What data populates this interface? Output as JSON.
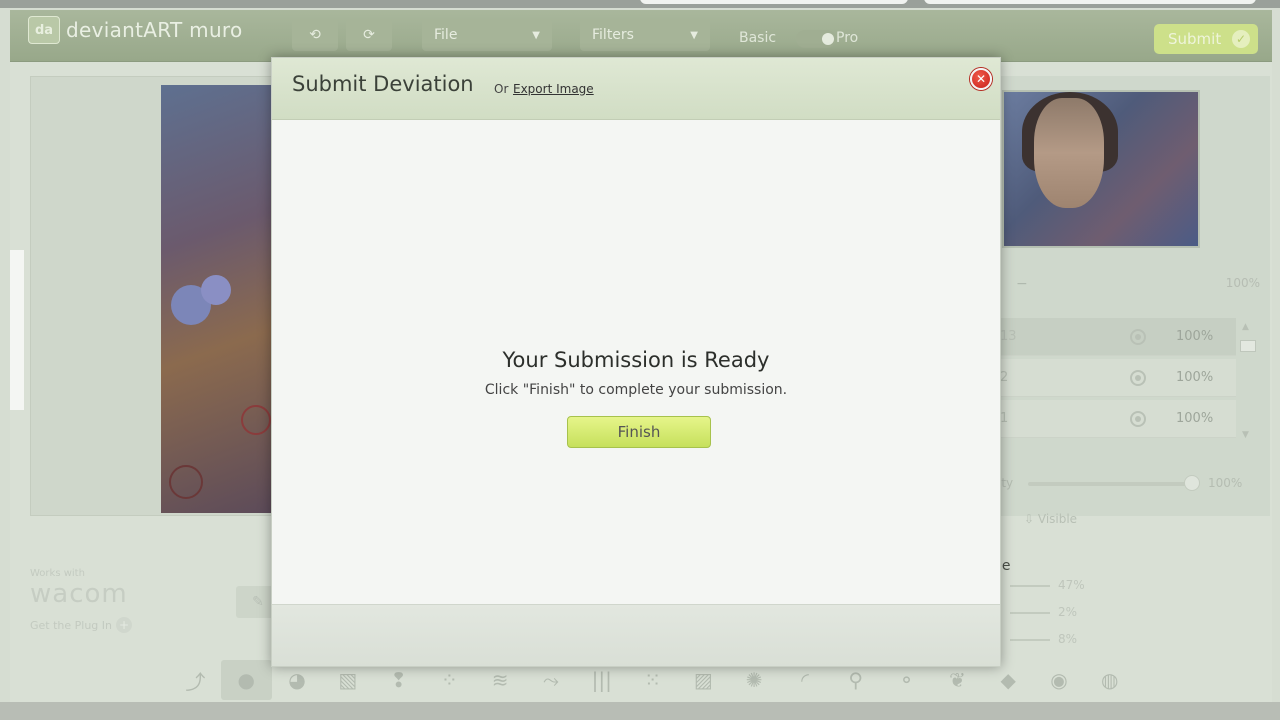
{
  "app": {
    "logo_badge": "da",
    "logo_text": "deviantART muro",
    "toolbar": {
      "undo_icon": "undo-icon",
      "redo_icon": "redo-icon",
      "file_label": "File",
      "filters_label": "Filters",
      "mode_basic": "Basic",
      "mode_pro": "Pro",
      "submit_label": "Submit"
    }
  },
  "side": {
    "zoom_minus": "−",
    "zoom_pct": "100%",
    "layers": [
      {
        "name": "13",
        "opacity": "100%"
      },
      {
        "name": "2",
        "opacity": "100%"
      },
      {
        "name": "1",
        "opacity": "100%"
      }
    ],
    "opacity_label": "ity",
    "opacity_pct": "100%",
    "visible_label": "⇩ Visible",
    "brush_title": "le",
    "brush_values": [
      "47%",
      "2%",
      "8%"
    ]
  },
  "wacom": {
    "works_with": "Works with",
    "brand": "wacom",
    "plug_in": "Get the Plug In"
  },
  "modal": {
    "title": "Submit Deviation",
    "or_text": "Or",
    "export_link": "Export Image",
    "close_icon": "close-icon",
    "ready_title": "Your Submission is Ready",
    "ready_subtitle": "Click \"Finish\" to complete your submission.",
    "finish_label": "Finish"
  },
  "brushes": [
    "⤴",
    "●",
    "◕",
    "▧",
    "❢",
    "⁘",
    "≋",
    "⤳",
    "|||",
    "⁙",
    "▨",
    "✺",
    "◜",
    "⚲",
    "⚬",
    "❦",
    "◆",
    "◉",
    "◍"
  ],
  "colors": {
    "header_green": "#98a88a",
    "finish_green": "#c6e05c",
    "close_red": "#c8201a"
  }
}
